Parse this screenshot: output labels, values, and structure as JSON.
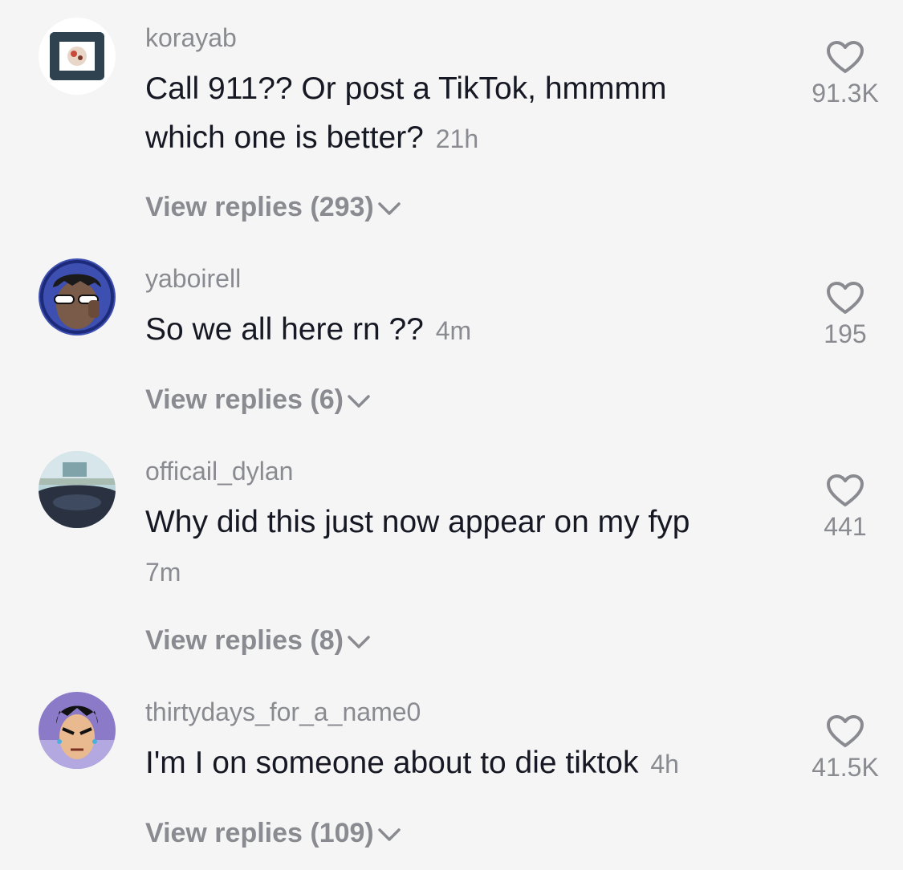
{
  "comments": [
    {
      "username": "korayab",
      "text_line1": "Call 911?? Or post a TikTok, hmmmm",
      "text_line2": "which one is better?",
      "time": "21h",
      "replies_label": "View replies (293)",
      "like_count": "91.3K",
      "avatar_icon": "hands-frame-avatar"
    },
    {
      "username": "yaboirell",
      "text_line1": "So we all here rn ??",
      "time": "4m",
      "replies_label": "View replies (6)",
      "like_count": "195",
      "avatar_icon": "sunglasses-person-avatar"
    },
    {
      "username": "officail_dylan",
      "text_line1": "Why did this just now appear on my fyp",
      "time": "7m",
      "replies_label": "View replies (8)",
      "like_count": "441",
      "avatar_icon": "car-window-photo-avatar"
    },
    {
      "username": "thirtydays_for_a_name0",
      "text_line1": "I'm I on someone about to die tiktok",
      "time": "4h",
      "replies_label": "View replies (109)",
      "like_count": "41.5K",
      "avatar_icon": "anime-character-avatar"
    }
  ],
  "colors": {
    "background": "#f5f5f5",
    "primary_text": "#161823",
    "secondary_text": "#8a8b91"
  }
}
